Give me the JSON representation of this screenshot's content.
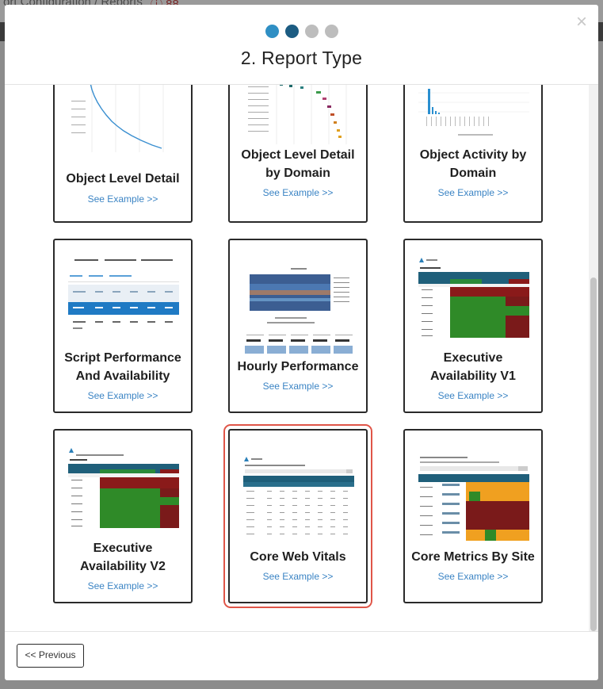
{
  "backdrop": {
    "title": "ort Configuration / Reports",
    "badge": "ⓘ 88"
  },
  "modal": {
    "title": "2. Report Type",
    "close_glyph": "×",
    "steps": [
      "step-1",
      "step-2",
      "step-3",
      "step-4"
    ],
    "current_step": 2,
    "previous_label": "<< Previous"
  },
  "colors": {
    "step_done": "#2f8fc4",
    "step_current": "#1c5c82",
    "step_pending": "#bdbdbd",
    "link": "#3b84c4",
    "selected_outline": "#e05548"
  },
  "cards": [
    {
      "line1": "Object Level Detail",
      "line2": "",
      "link": "See Example >>"
    },
    {
      "line1": "Object Level Detail",
      "line2": "by Domain",
      "link": "See Example >>"
    },
    {
      "line1": "Object Activity by",
      "line2": "Domain",
      "link": "See Example >>"
    },
    {
      "line1": "Script Performance",
      "line2": "And Availability",
      "link": "See Example >>"
    },
    {
      "line1": "Hourly Performance",
      "line2": "",
      "link": "See Example >>"
    },
    {
      "line1": "Executive",
      "line2": "Availability V1",
      "link": "See Example >>"
    },
    {
      "line1": "Executive",
      "line2": "Availability V2",
      "link": "See Example >>"
    },
    {
      "line1": "Core Web Vitals",
      "line2": "",
      "link": "See Example >>"
    },
    {
      "line1": "Core Metrics By Site",
      "line2": "",
      "link": "See Example >>"
    }
  ],
  "selected_card": "Core Web Vitals"
}
